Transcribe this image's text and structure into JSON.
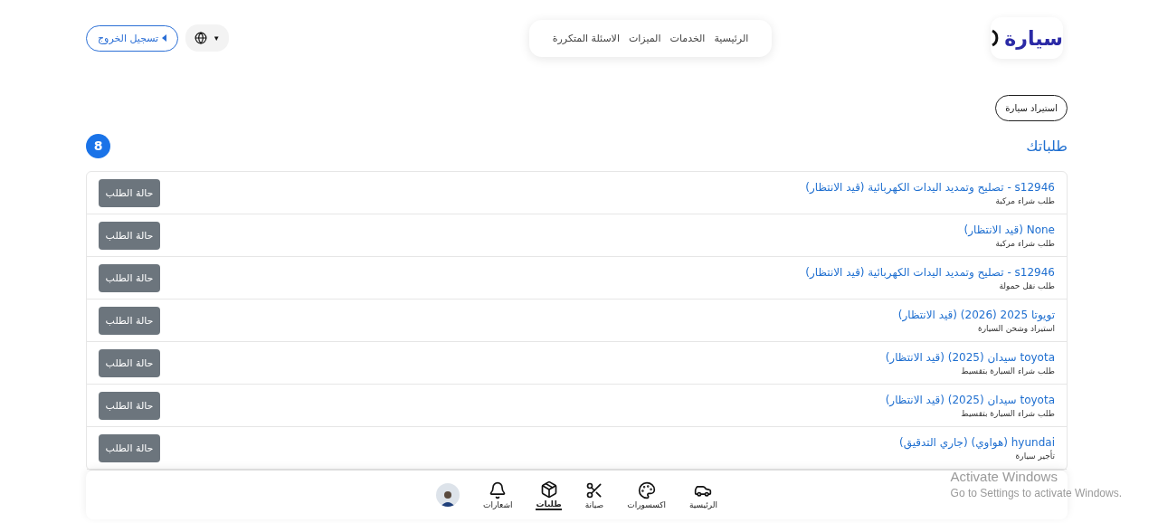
{
  "header": {
    "logo": "سيارة",
    "nav": [
      "الرئيسية",
      "الخدمات",
      "الميزات",
      "الاسئلة المتكررة"
    ],
    "language_caret": "▼",
    "logout": "تسجيل الخروج"
  },
  "import_button": "استيراد سيارة",
  "orders": {
    "title": "طلباتك",
    "count": "8",
    "rows": [
      {
        "title": "s12946 - تصليح وتمديد اليدات الكهربائية (قيد الانتظار)",
        "subtitle": "طلب شراء مركبة",
        "status_button": "حالة الطلب"
      },
      {
        "title": "None (قيد الانتظار)",
        "subtitle": "طلب شراء مركبة",
        "status_button": "حالة الطلب"
      },
      {
        "title": "s12946 - تصليح وتمديد اليدات الكهربائية (قيد الانتظار)",
        "subtitle": "طلب نقل حمولة",
        "status_button": "حالة الطلب"
      },
      {
        "title": "تويوتا 2025 (2026) (قيد الانتظار)",
        "subtitle": "استيراد وشحن السيارة",
        "status_button": "حالة الطلب"
      },
      {
        "title": "toyota سيدان (2025) (قيد الانتظار)",
        "subtitle": "طلب شراء السيارة بتقسيط",
        "status_button": "حالة الطلب"
      },
      {
        "title": "toyota سيدان (2025) (قيد الانتظار)",
        "subtitle": "طلب شراء السيارة بتقسيط",
        "status_button": "حالة الطلب"
      },
      {
        "title": "hyundai (هواوي) (جاري التدقيق)",
        "subtitle": "تأجير سيارة",
        "status_button": "حالة الطلب"
      }
    ]
  },
  "bottom_nav": [
    {
      "kind": "car",
      "label": "الرئيسية",
      "selected": false
    },
    {
      "kind": "palette",
      "label": "اكسسورات",
      "selected": false
    },
    {
      "kind": "scissors",
      "label": "صيانة",
      "selected": false
    },
    {
      "kind": "box",
      "label": "طلبات",
      "selected": true
    },
    {
      "kind": "bell",
      "label": "اشعارات",
      "selected": false
    },
    {
      "kind": "avatar",
      "selected": false
    }
  ],
  "os_overlay": {
    "title": "Activate Windows",
    "hint": "Go to Settings to activate Windows."
  }
}
